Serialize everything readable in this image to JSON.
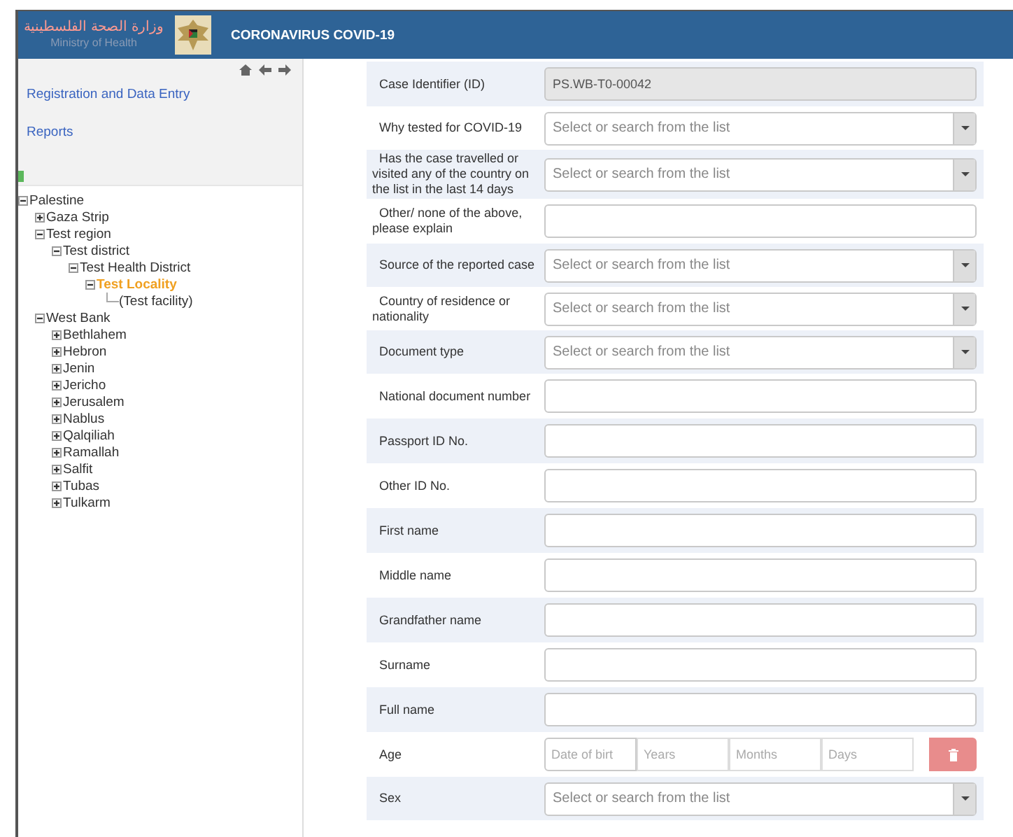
{
  "header": {
    "arabic_title": "وزارة الصحة الفلسطينية",
    "subtitle": "Ministry of Health",
    "app_title": "CORONAVIRUS COVID-19"
  },
  "sidebar": {
    "links": [
      "Registration and Data Entry",
      "Reports"
    ],
    "tree": [
      {
        "label": "Palestine",
        "expanded": true,
        "selected": false,
        "children": [
          {
            "label": "Gaza Strip",
            "expanded": false,
            "selected": false
          },
          {
            "label": "Test region",
            "expanded": true,
            "selected": false,
            "children": [
              {
                "label": "Test district",
                "expanded": true,
                "selected": false,
                "children": [
                  {
                    "label": "Test Health District",
                    "expanded": true,
                    "selected": false,
                    "children": [
                      {
                        "label": "Test Locality",
                        "expanded": true,
                        "selected": true,
                        "children": [
                          {
                            "label": "(Test facility)",
                            "selected": false
                          }
                        ]
                      }
                    ]
                  }
                ]
              }
            ]
          },
          {
            "label": "West Bank",
            "expanded": true,
            "selected": false,
            "children": [
              {
                "label": "Bethlahem",
                "expanded": false,
                "selected": false
              },
              {
                "label": "Hebron",
                "expanded": false,
                "selected": false
              },
              {
                "label": "Jenin",
                "expanded": false,
                "selected": false
              },
              {
                "label": "Jericho",
                "expanded": false,
                "selected": false
              },
              {
                "label": "Jerusalem",
                "expanded": false,
                "selected": false
              },
              {
                "label": "Nablus",
                "expanded": false,
                "selected": false
              },
              {
                "label": "Qalqiliah",
                "expanded": false,
                "selected": false
              },
              {
                "label": "Ramallah",
                "expanded": false,
                "selected": false
              },
              {
                "label": "Salfit",
                "expanded": false,
                "selected": false
              },
              {
                "label": "Tubas",
                "expanded": false,
                "selected": false
              },
              {
                "label": "Tulkarm",
                "expanded": false,
                "selected": false
              }
            ]
          }
        ]
      }
    ]
  },
  "form": {
    "rows": [
      {
        "kind": "readonly",
        "label": "Case Identifier (ID)",
        "value": "PS.WB-T0-00042"
      },
      {
        "kind": "select",
        "label": "Why tested for COVID-19",
        "placeholder": "Select or search from the list"
      },
      {
        "kind": "select",
        "label": "Has the case travelled or visited any of the country on the list in the last 14 days",
        "placeholder": "Select or search from the list"
      },
      {
        "kind": "text",
        "label": "Other/ none of the above, please explain"
      },
      {
        "kind": "select",
        "label": "Source of the reported case",
        "placeholder": "Select or search from the list"
      },
      {
        "kind": "select",
        "label": "Country of residence or nationality",
        "placeholder": "Select or search from the list"
      },
      {
        "kind": "select",
        "label": "Document type",
        "placeholder": "Select or search from the list"
      },
      {
        "kind": "text",
        "label": "National document number"
      },
      {
        "kind": "text",
        "label": "Passport ID No."
      },
      {
        "kind": "text",
        "label": "Other ID No."
      },
      {
        "kind": "text",
        "label": "First name"
      },
      {
        "kind": "text",
        "label": "Middle name"
      },
      {
        "kind": "text",
        "label": "Grandfather name"
      },
      {
        "kind": "text",
        "label": "Surname"
      },
      {
        "kind": "text",
        "label": "Full name"
      },
      {
        "kind": "age",
        "label": "Age",
        "placeholders": [
          "Date of birt",
          "Years",
          "Months",
          "Days"
        ]
      },
      {
        "kind": "select",
        "label": "Sex",
        "placeholder": "Select or search from the list"
      }
    ]
  }
}
